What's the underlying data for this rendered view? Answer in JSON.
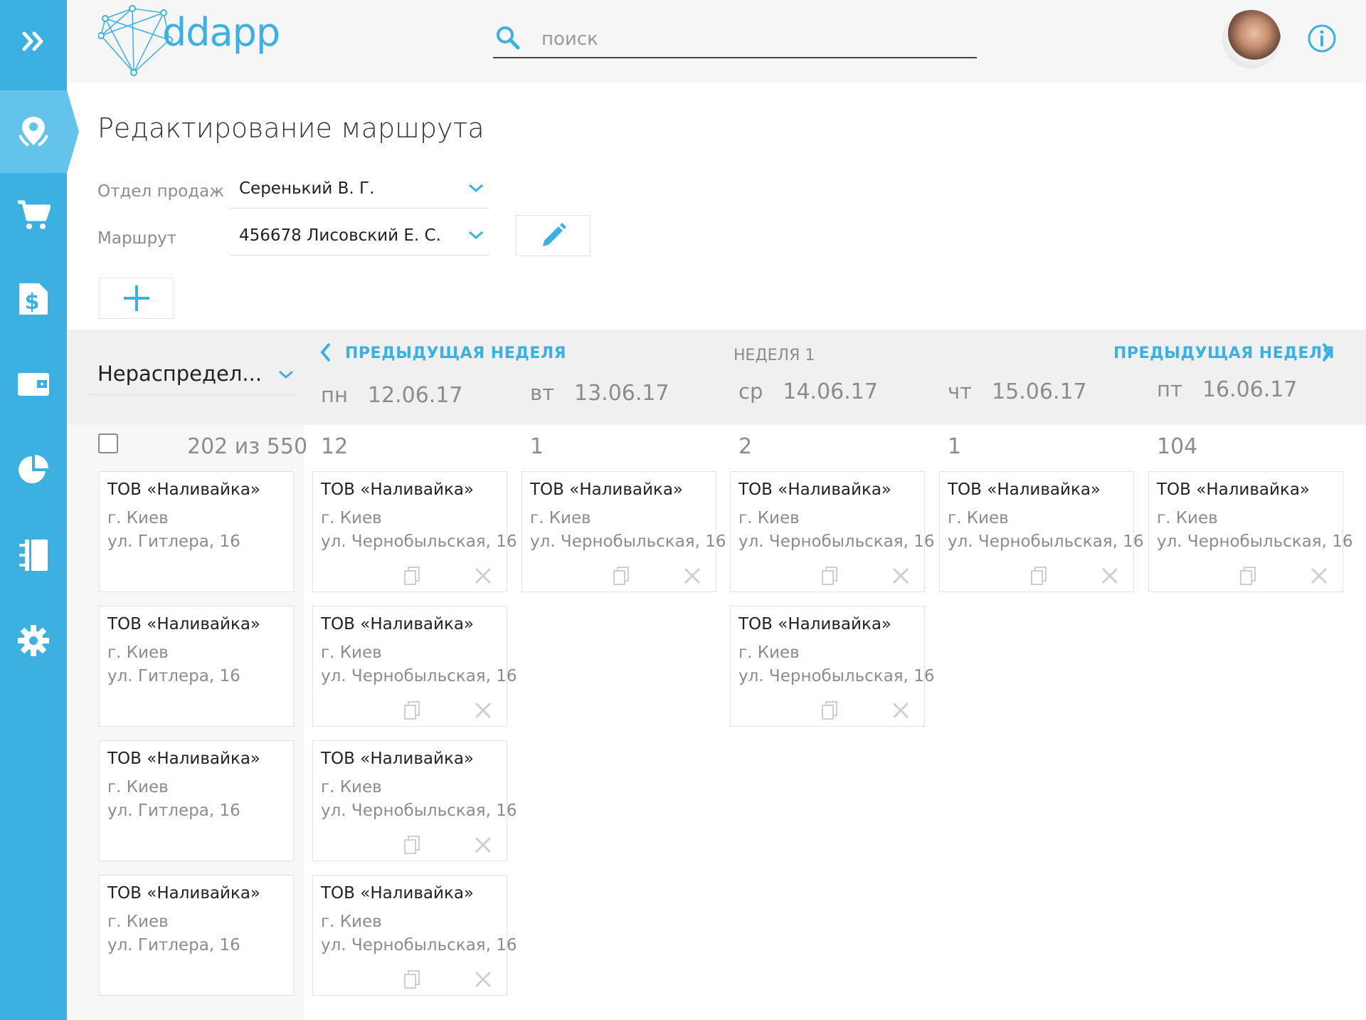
{
  "app": {
    "logo_text": "ddapp"
  },
  "search": {
    "placeholder": "поиск"
  },
  "sidebar": {
    "items": [
      {
        "icon": "expand-icon"
      },
      {
        "icon": "map-pin-icon",
        "active": true
      },
      {
        "icon": "cart-icon"
      },
      {
        "icon": "dollar-doc-icon"
      },
      {
        "icon": "wallet-icon"
      },
      {
        "icon": "pie-chart-icon"
      },
      {
        "icon": "notebook-icon"
      },
      {
        "icon": "gear-icon"
      }
    ]
  },
  "page": {
    "title": "Редактирование маршрута"
  },
  "form": {
    "department_label": "Отдел продаж",
    "department_value": "Серенький В. Г.",
    "route_label": "Маршрут",
    "route_value": "456678 Лисовский Е. С."
  },
  "week_nav": {
    "prev_label": "ПРЕДЫДУЩАЯ НЕДЕЛЯ",
    "next_label": "ПРЕДЫДУЩАЯ НЕДЕЛЯ",
    "week_label": "НЕДЕЛЯ 1"
  },
  "unassigned": {
    "select_value": "Нераспредел...",
    "count_text": "202 из 550",
    "cards": [
      {
        "name": "ТОВ «Наливайка»",
        "city": "г. Киев",
        "address": "ул. Гитлера, 16"
      },
      {
        "name": "ТОВ «Наливайка»",
        "city": "г. Киев",
        "address": "ул. Гитлера, 16"
      },
      {
        "name": "ТОВ «Наливайка»",
        "city": "г. Киев",
        "address": "ул. Гитлера, 16"
      },
      {
        "name": "ТОВ «Наливайка»",
        "city": "г. Киев",
        "address": "ул. Гитлера, 16"
      }
    ]
  },
  "days": [
    {
      "day": "пн",
      "date": "12.06.17",
      "count": "12",
      "cards": [
        {
          "name": "ТОВ «Наливайка»",
          "city": "г. Киев",
          "address": "ул. Чернобыльская, 16"
        },
        {
          "name": "ТОВ «Наливайка»",
          "city": "г. Киев",
          "address": "ул. Чернобыльская, 16"
        },
        {
          "name": "ТОВ «Наливайка»",
          "city": "г. Киев",
          "address": "ул. Чернобыльская, 16"
        },
        {
          "name": "ТОВ «Наливайка»",
          "city": "г. Киев",
          "address": "ул. Чернобыльская, 16"
        }
      ]
    },
    {
      "day": "вт",
      "date": "13.06.17",
      "count": "1",
      "cards": [
        {
          "name": "ТОВ «Наливайка»",
          "city": "г. Киев",
          "address": "ул. Чернобыльская, 16"
        }
      ]
    },
    {
      "day": "ср",
      "date": "14.06.17",
      "count": "2",
      "cards": [
        {
          "name": "ТОВ «Наливайка»",
          "city": "г. Киев",
          "address": "ул. Чернобыльская, 16"
        },
        {
          "name": "ТОВ «Наливайка»",
          "city": "г. Киев",
          "address": "ул. Чернобыльская, 16"
        }
      ]
    },
    {
      "day": "чт",
      "date": "15.06.17",
      "count": "1",
      "cards": [
        {
          "name": "ТОВ «Наливайка»",
          "city": "г. Киев",
          "address": "ул. Чернобыльская, 16"
        }
      ]
    },
    {
      "day": "пт",
      "date": "16.06.17",
      "count": "104",
      "cards": [
        {
          "name": "ТОВ «Наливайка»",
          "city": "г. Киев",
          "address": "ул. Чернобыльская, 16"
        }
      ]
    }
  ],
  "colors": {
    "accent": "#3cb1e1",
    "sidebar_active": "#63c3ea",
    "muted_text": "#8c8c8c"
  }
}
